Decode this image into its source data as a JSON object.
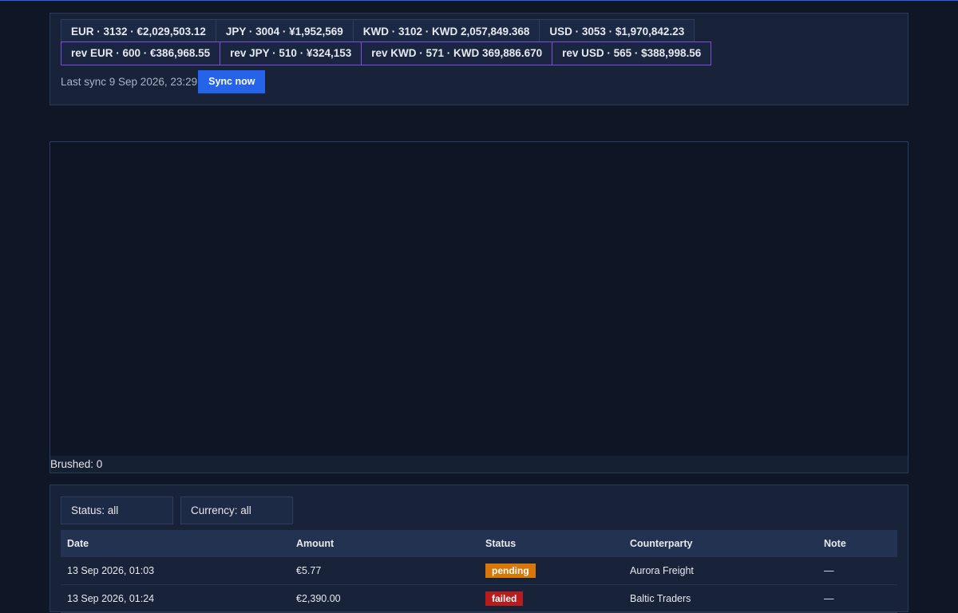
{
  "summary": {
    "totals": [
      {
        "label": "EUR · 3132 · €2,029,503.12"
      },
      {
        "label": "JPY · 3004 · ¥1,952,569"
      },
      {
        "label": "KWD · 3102 · KWD 2,057,849.368"
      },
      {
        "label": "USD · 3053 · $1,970,842.23"
      }
    ],
    "reversed": [
      {
        "label": "rev EUR · 600 · €386,968.55"
      },
      {
        "label": "rev JPY · 510 · ¥324,153"
      },
      {
        "label": "rev KWD · 571 · KWD 369,886.670"
      },
      {
        "label": "rev USD · 565 · $388,998.56"
      }
    ],
    "last_sync": "Last sync 9 Sep 2026, 23:29",
    "sync_button": "Sync now"
  },
  "chart": {
    "brushed_label": "Brushed: 0"
  },
  "filters": {
    "status": "Status: all",
    "currency": "Currency: all"
  },
  "table": {
    "columns": [
      "Date",
      "Amount",
      "Status",
      "Counterparty",
      "Note"
    ],
    "rows": [
      {
        "date": "13 Sep 2026, 01:03",
        "amount": "€5.77",
        "status": "pending",
        "counterparty": "Aurora Freight",
        "note": "—"
      },
      {
        "date": "13 Sep 2026, 01:24",
        "amount": "€2,390.00",
        "status": "failed",
        "counterparty": "Baltic Traders",
        "note": "—"
      }
    ]
  },
  "colors": {
    "accent": "#2563eb",
    "reversed_border": "#7c4dde",
    "pending": "#d97706",
    "failed": "#b91c1c"
  }
}
